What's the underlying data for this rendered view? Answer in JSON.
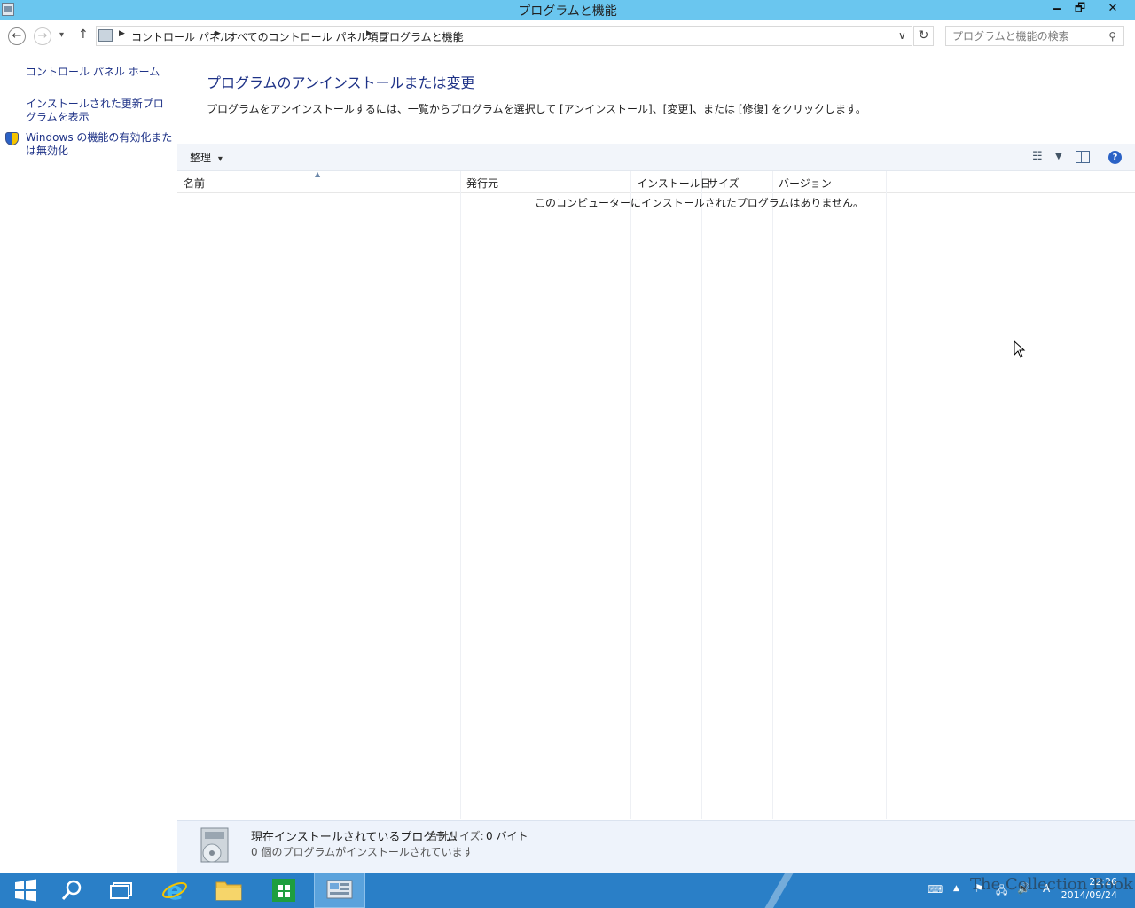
{
  "window": {
    "title": "プログラムと機能",
    "minimize": "🗕",
    "restore": "🗗",
    "close": "✕"
  },
  "address": {
    "back": "←",
    "forward": "→",
    "recent": "▾",
    "up": "↑",
    "breadcrumbs": [
      "コントロール パネル",
      "すべてのコントロール パネル項目",
      "プログラムと機能"
    ],
    "dropdown": "∨",
    "refresh": "↻",
    "search_placeholder": "プログラムと機能の検索"
  },
  "sidebar": {
    "items": [
      "コントロール パネル ホーム",
      "インストールされた更新プログラムを表示",
      "Windows の機能の有効化または無効化"
    ]
  },
  "main": {
    "title": "プログラムのアンインストールまたは変更",
    "description": "プログラムをアンインストールするには、一覧からプログラムを選択して [アンインストール]、[変更]、または [修復] をクリックします。"
  },
  "toolbar": {
    "organize": "整理",
    "organize_arrow": "▾",
    "help": "?"
  },
  "table": {
    "columns": [
      "名前",
      "発行元",
      "インストール日",
      "サイズ",
      "バージョン"
    ],
    "empty_message": "このコンピューターにインストールされたプログラムはありません。"
  },
  "details": {
    "title": "現在インストールされているプログラム",
    "total_size_label": "合計サイズ:",
    "total_size_value": "0 バイト",
    "count_text": "0 個のプログラムがインストールされています"
  },
  "taskbar": {
    "time": "22:26",
    "date": "2014/09/24",
    "ime": "A"
  },
  "watermark": "The Collection Book"
}
